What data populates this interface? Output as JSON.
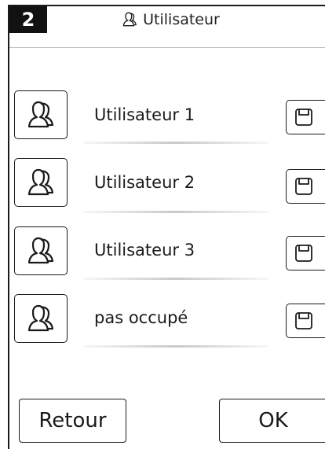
{
  "header": {
    "step_number": "2",
    "title": "Utilisateur",
    "title_icon": "user-icon"
  },
  "users": [
    {
      "label": "Utilisateur 1",
      "icon": "user-icon",
      "save_icon": "save-icon"
    },
    {
      "label": "Utilisateur 2",
      "icon": "user-icon",
      "save_icon": "save-icon"
    },
    {
      "label": "Utilisateur 3",
      "icon": "user-icon",
      "save_icon": "save-icon"
    },
    {
      "label": "pas occupé",
      "icon": "user-icon",
      "save_icon": "save-icon"
    }
  ],
  "footer": {
    "back_label": "Retour",
    "ok_label": "OK"
  }
}
